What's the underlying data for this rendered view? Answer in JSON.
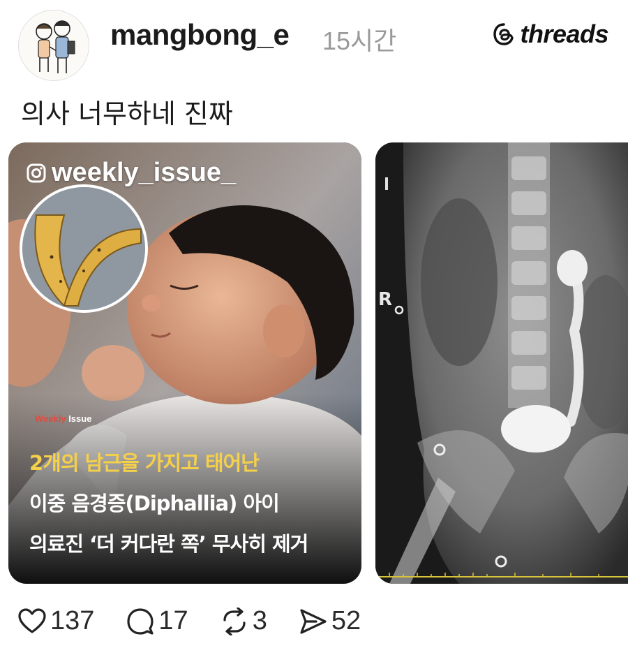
{
  "post": {
    "username": "mangbong_e",
    "timestamp": "15시간",
    "caption": "의사 너무하네 진짜"
  },
  "brand": {
    "name": "threads"
  },
  "media": {
    "card1": {
      "instagram_handle": "weekly_issue_",
      "publisher_accent": "Weekly",
      "publisher_rest": " Issue",
      "headline_line1": "2개의 남근을 가지고 태어난",
      "headline_line2": "이중 음경증(Diphallia) 아이",
      "headline_line3": "의료진 ‘더 커다란 쪽’ 무사히 제거"
    },
    "card2": {
      "marker": "R"
    }
  },
  "actions": {
    "likes": "137",
    "comments": "17",
    "reposts": "3",
    "shares": "52"
  },
  "colors": {
    "headline_highlight": "#f5d04a",
    "publisher_accent": "#e04b3f",
    "timestamp": "#9a9a9a"
  },
  "icons": [
    "heart-icon",
    "comment-icon",
    "repost-icon",
    "share-icon",
    "threads-logo-icon",
    "instagram-icon"
  ]
}
